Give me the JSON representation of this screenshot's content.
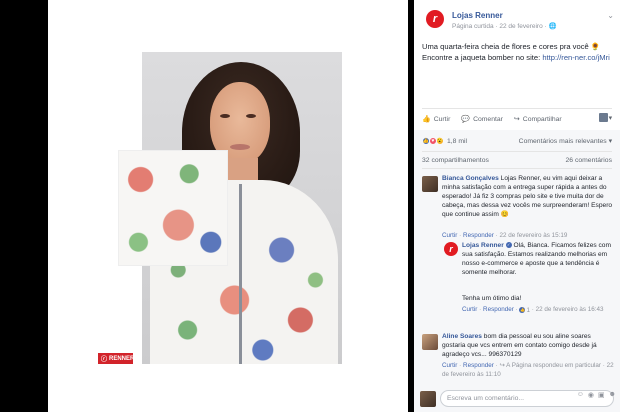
{
  "photo": {
    "brand_tag": "RENNER"
  },
  "post": {
    "page_name": "Lojas Renner",
    "meta_type": "Página curtida",
    "meta_date": "22 de fevereiro",
    "text": "Uma quarta-feira cheia de flores e cores pra você 🌻 Encontre a jaqueta bomber no site: ",
    "link": "http://ren-ner.co/jMri",
    "actions": {
      "like": "Curtir",
      "comment": "Comentar",
      "share": "Compartilhar"
    },
    "reactions_count": "1,8 mil",
    "sort_label": "Comentários mais relevantes",
    "shares": "32 compartilhamentos",
    "comments_count": "26 comentários"
  },
  "comments": [
    {
      "name": "Bianca Gonçalves",
      "text": "Lojas Renner, eu vim aqui deixar a minha satisfação com a entrega super rápida a antes do esperado! Já fiz 3 compras pelo site e tive muita dor de cabeça, mas dessa vez vocês me surpreenderam! Espero que continue assim 😊",
      "like": "Curtir",
      "reply": "Responder",
      "date": "22 de fevereiro às 15:19"
    },
    {
      "name": "Lojas Renner",
      "text": "Olá, Bianca. Ficamos felizes com sua satisfação. Estamos realizando melhorias em nosso e-commerce e aposte que a tendência é somente melhorar.",
      "text2": "Tenha um ótimo dia!",
      "like": "Curtir",
      "reply": "Responder",
      "likes": "1",
      "date": "22 de fevereiro às 16:43"
    },
    {
      "name": "Aline Soares",
      "text": "bom dia pessoal eu sou aline soares gostaria que vcs entrem em contato comigo desde já agradeço vcs... 996370129",
      "like": "Curtir",
      "reply": "Responder",
      "extra": "A Página respondeu em particular",
      "date": "22 de fevereiro às 11:10"
    }
  ],
  "compose": {
    "placeholder": "Escreva um comentário..."
  },
  "colors": {
    "brand_red": "#e11b22",
    "fb_blue": "#365899",
    "muted": "#90949c"
  }
}
